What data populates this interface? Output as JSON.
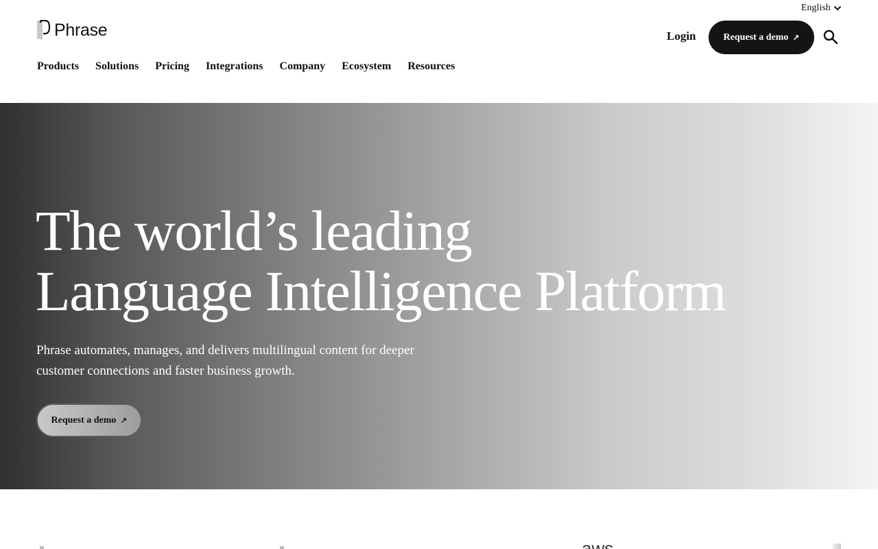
{
  "header": {
    "language": "English",
    "brand": "Phrase",
    "login_label": "Login",
    "demo_label": "Request a demo",
    "arrow_glyph": "↗"
  },
  "nav": {
    "items": [
      "Products",
      "Solutions",
      "Pricing",
      "Integrations",
      "Company",
      "Ecosystem",
      "Resources"
    ]
  },
  "hero": {
    "title_line1": "The world’s leading",
    "title_line2": "Language Intelligence Platform",
    "subtitle": "Phrase automates, manages, and delivers multilingual content for deeper customer connections and faster business growth.",
    "cta_label": "Request a demo",
    "gradient": [
      "#303030",
      "#f4f4f4"
    ]
  },
  "logos": {
    "partial_visible": "aws"
  },
  "colors": {
    "button_dark": "#141414",
    "text_dark": "#111111",
    "hero_text": "#ffffff"
  }
}
